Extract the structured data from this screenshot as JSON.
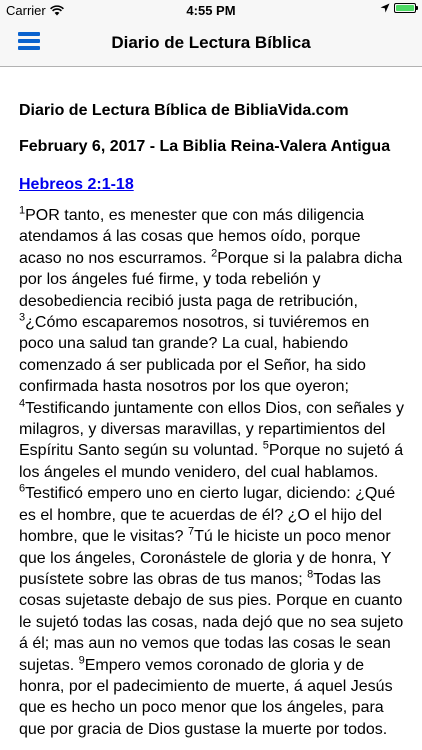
{
  "status": {
    "carrier": "Carrier",
    "time": "4:55 PM"
  },
  "nav": {
    "title": "Diario de Lectura Bíblica"
  },
  "content": {
    "site_heading": "Diario de Lectura Bíblica de BibliaVida.com",
    "date_heading": "February 6, 2017 - La Biblia Reina-Valera Antigua",
    "reference": "Hebreos 2:1-18",
    "verses": [
      {
        "num": "1",
        "text": "POR tanto, es menester que con más diligencia atendamos á las cosas que hemos oído, porque acaso no nos escurramos. "
      },
      {
        "num": "2",
        "text": "Porque si la palabra dicha por los ángeles fué firme, y toda rebelión y desobediencia recibió justa paga de retribución, "
      },
      {
        "num": "3",
        "text": "¿Cómo escaparemos nosotros, si tuviéremos en poco una salud tan grande? La cual, habiendo comenzado á ser publicada por el Señor, ha sido confirmada hasta nosotros por los que oyeron; "
      },
      {
        "num": "4",
        "text": "Testificando juntamente con ellos Dios, con señales y milagros, y diversas maravillas, y repartimientos del Espíritu Santo según su voluntad. "
      },
      {
        "num": "5",
        "text": "Porque no sujetó á los ángeles el mundo venidero, del cual hablamos. "
      },
      {
        "num": "6",
        "text": "Testificó empero uno en cierto lugar, diciendo: ¿Qué es el hombre, que te acuerdas de él? ¿O el hijo del hombre, que le visitas? "
      },
      {
        "num": "7",
        "text": "Tú le hiciste un poco menor que los ángeles, Coronástele de gloria y de honra, Y pusístete sobre las obras de tus manos; "
      },
      {
        "num": "8",
        "text": "Todas las cosas sujetaste debajo de sus pies. Porque en cuanto le sujetó todas las cosas, nada dejó que no sea sujeto á él; mas aun no vemos que todas las cosas le sean sujetas. "
      },
      {
        "num": "9",
        "text": "Empero vemos coronado de gloria y de honra, por el padecimiento de muerte, á aquel Jesús que es hecho un poco menor que los ángeles, para que por gracia de Dios gustase la muerte por todos."
      }
    ]
  }
}
